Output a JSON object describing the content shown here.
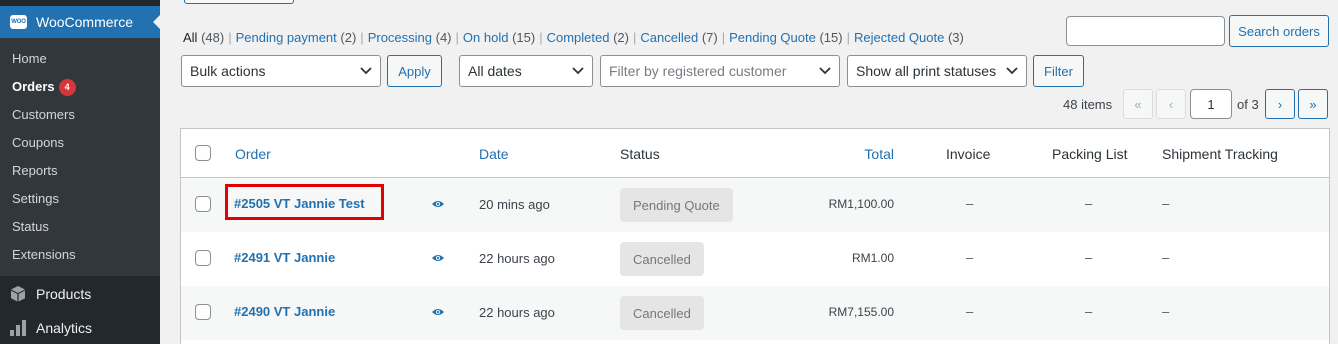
{
  "sidebar": {
    "brand": "WooCommerce",
    "brand_logo_text": "WOO",
    "submenu": [
      {
        "label": "Home"
      },
      {
        "label": "Orders",
        "badge": "4",
        "current": true
      },
      {
        "label": "Customers"
      },
      {
        "label": "Coupons"
      },
      {
        "label": "Reports"
      },
      {
        "label": "Settings"
      },
      {
        "label": "Status"
      },
      {
        "label": "Extensions"
      }
    ],
    "products_label": "Products",
    "analytics_label": "Analytics"
  },
  "status_links": [
    {
      "label": "All",
      "count": "(48)"
    },
    {
      "label": "Pending payment",
      "count": "(2)"
    },
    {
      "label": "Processing",
      "count": "(4)"
    },
    {
      "label": "On hold",
      "count": "(15)"
    },
    {
      "label": "Completed",
      "count": "(2)"
    },
    {
      "label": "Cancelled",
      "count": "(7)"
    },
    {
      "label": "Pending Quote",
      "count": "(15)"
    },
    {
      "label": "Rejected Quote",
      "count": "(3)"
    }
  ],
  "search": {
    "value": "",
    "button_label": "Search orders"
  },
  "filters": {
    "bulk_actions": "Bulk actions",
    "apply_label": "Apply",
    "dates": "All dates",
    "customer_placeholder": "Filter by registered customer",
    "print_status": "Show all print statuses",
    "filter_label": "Filter"
  },
  "pagination": {
    "items": "48 items",
    "first": "«",
    "prev": "‹",
    "current_page": "1",
    "of_pages": "of 3",
    "next": "›",
    "last": "»"
  },
  "columns": {
    "order": "Order",
    "date": "Date",
    "status": "Status",
    "total": "Total",
    "invoice": "Invoice",
    "packing_list": "Packing List",
    "shipment_tracking": "Shipment Tracking"
  },
  "rows": [
    {
      "order": "#2505 VT Jannie Test",
      "date": "20 mins ago",
      "status": "Pending Quote",
      "total": "RM1,100.00",
      "invoice": "–",
      "packing": "–",
      "tracking": "–"
    },
    {
      "order": "#2491 VT Jannie",
      "date": "22 hours ago",
      "status": "Cancelled",
      "total": "RM1.00",
      "invoice": "–",
      "packing": "–",
      "tracking": "–"
    },
    {
      "order": "#2490 VT Jannie",
      "date": "22 hours ago",
      "status": "Cancelled",
      "total": "RM7,155.00",
      "invoice": "–",
      "packing": "–",
      "tracking": "–"
    }
  ],
  "colors": {
    "accent": "#2271b1",
    "sidebar": "#23282d",
    "highlight": "#e20000"
  }
}
